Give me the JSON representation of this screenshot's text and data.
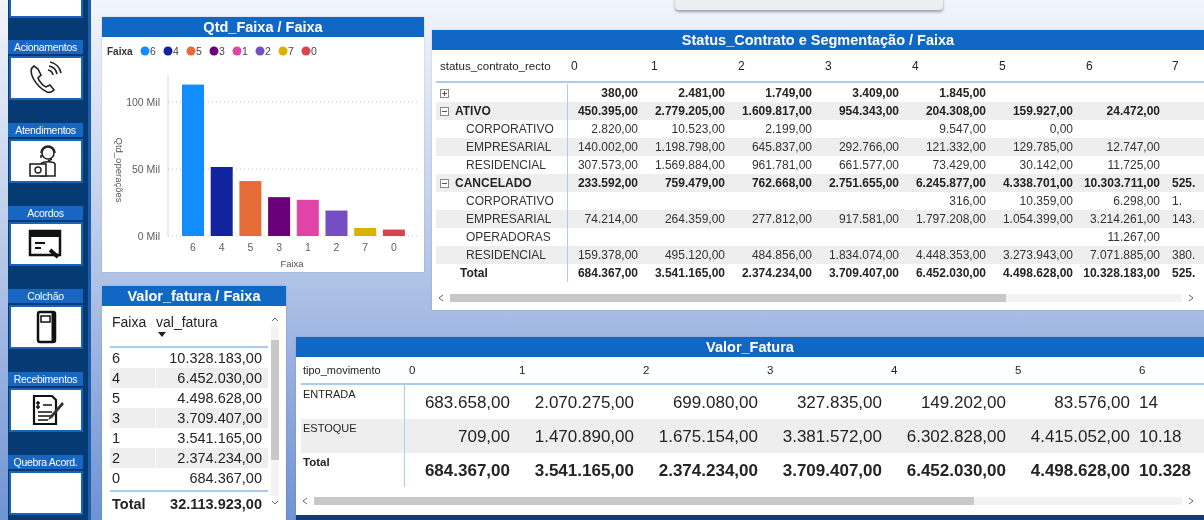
{
  "sidebar": {
    "items": [
      {
        "label": "Acionamentos",
        "kind": "phone"
      },
      {
        "label": "Atendimentos",
        "kind": "agent"
      },
      {
        "label": "Acordos",
        "kind": "agreement"
      },
      {
        "label": "Colchão",
        "kind": "notebook"
      },
      {
        "label": "Recebimentos",
        "kind": "invoice"
      },
      {
        "label": "Quebra Acord.",
        "kind": "blank"
      }
    ]
  },
  "qtd_chart": {
    "title": "Qtd_Faixa / Faixa",
    "legend_title": "Faixa",
    "chart_data": {
      "type": "bar",
      "xlabel": "Faixa",
      "ylabel": "Qtd_operações",
      "categories": [
        "6",
        "4",
        "5",
        "3",
        "1",
        "2",
        "7",
        "0"
      ],
      "stacked": true,
      "legend": "top-left",
      "ylim": [
        0,
        120
      ],
      "yticks": [
        {
          "value": 0,
          "label": "0 Mil"
        },
        {
          "value": 50,
          "label": "50 Mil"
        },
        {
          "value": 100,
          "label": "100 Mil"
        }
      ],
      "series": [
        {
          "name": "6",
          "color": "#118dff",
          "values": [
            113,
            null,
            null,
            null,
            null,
            null,
            null,
            null
          ]
        },
        {
          "name": "4",
          "color": "#12239e",
          "values": [
            null,
            51.5,
            null,
            null,
            null,
            null,
            null,
            null
          ]
        },
        {
          "name": "5",
          "color": "#e66c37",
          "values": [
            null,
            null,
            41,
            null,
            null,
            null,
            null,
            null
          ]
        },
        {
          "name": "3",
          "color": "#6b007b",
          "values": [
            null,
            null,
            null,
            29,
            null,
            null,
            null,
            null
          ]
        },
        {
          "name": "1",
          "color": "#e044a7",
          "values": [
            null,
            null,
            null,
            null,
            27,
            null,
            null,
            null
          ]
        },
        {
          "name": "2",
          "color": "#744ec2",
          "values": [
            null,
            null,
            null,
            null,
            null,
            19,
            null,
            null
          ]
        },
        {
          "name": "7",
          "color": "#d9b300",
          "values": [
            null,
            null,
            null,
            null,
            null,
            null,
            6,
            null
          ]
        },
        {
          "name": "0",
          "color": "#d64550",
          "values": [
            null,
            null,
            null,
            null,
            null,
            null,
            null,
            4.8
          ]
        }
      ]
    }
  },
  "status_matrix": {
    "title": "Status_Contrato e Segmentação / Faixa",
    "row_header": "status_contrato_recto",
    "columns": [
      "0",
      "1",
      "2",
      "3",
      "4",
      "5",
      "6",
      "7"
    ],
    "rows": [
      {
        "expanded": false,
        "cells": {
          "col_0": "380,00",
          "col_1": "2.481,00",
          "col_2": "1.749,00",
          "col_3": "3.409,00",
          "col_4": "1.845,00"
        }
      },
      {
        "label": "ATIVO",
        "expanded": true,
        "cells": {
          "col_0": "450.395,00",
          "col_1": "2.779.205,00",
          "col_2": "1.609.817,00",
          "col_3": "954.343,00",
          "col_4": "204.308,00",
          "col_5": "159.927,00",
          "col_6": "24.472,00"
        },
        "children": [
          {
            "label": "CORPORATIVO",
            "cells": {
              "col_0": "2.820,00",
              "col_1": "10.523,00",
              "col_2": "2.199,00",
              "col_4": "9.547,00",
              "col_5": "0,00"
            }
          },
          {
            "label": "EMPRESARIAL",
            "cells": {
              "col_0": "140.002,00",
              "col_1": "1.198.798,00",
              "col_2": "645.837,00",
              "col_3": "292.766,00",
              "col_4": "121.332,00",
              "col_5": "129.785,00",
              "col_6": "12.747,00"
            }
          },
          {
            "label": "RESIDENCIAL",
            "cells": {
              "col_0": "307.573,00",
              "col_1": "1.569.884,00",
              "col_2": "961.781,00",
              "col_3": "661.577,00",
              "col_4": "73.429,00",
              "col_5": "30.142,00",
              "col_6": "11.725,00"
            }
          }
        ]
      },
      {
        "label": "CANCELADO",
        "expanded": true,
        "cells": {
          "col_0": "233.592,00",
          "col_1": "759.479,00",
          "col_2": "762.668,00",
          "col_3": "2.751.655,00",
          "col_4": "6.245.877,00",
          "col_5": "4.338.701,00",
          "col_6": "10.303.711,00",
          "col_7": "525."
        },
        "children": [
          {
            "label": "CORPORATIVO",
            "cells": {
              "col_4": "316,00",
              "col_5": "10.359,00",
              "col_6": "6.298,00",
              "col_7": "1."
            }
          },
          {
            "label": "EMPRESARIAL",
            "cells": {
              "col_0": "74.214,00",
              "col_1": "264.359,00",
              "col_2": "277.812,00",
              "col_3": "917.581,00",
              "col_4": "1.797.208,00",
              "col_5": "1.054.399,00",
              "col_6": "3.214.261,00",
              "col_7": "143."
            }
          },
          {
            "label": "OPERADORAS",
            "cells": {
              "col_6": "11.267,00"
            }
          },
          {
            "label": "RESIDENCIAL",
            "cells": {
              "col_0": "159.378,00",
              "col_1": "495.120,00",
              "col_2": "484.856,00",
              "col_3": "1.834.074,00",
              "col_4": "4.448.353,00",
              "col_5": "3.273.943,00",
              "col_6": "7.071.885,00",
              "col_7": "380."
            }
          }
        ]
      }
    ],
    "total": {
      "label": "Total",
      "cells": {
        "col_0": "684.367,00",
        "col_1": "3.541.165,00",
        "col_2": "2.374.234,00",
        "col_3": "3.709.407,00",
        "col_4": "6.452.030,00",
        "col_5": "4.498.628,00",
        "col_6": "10.328.183,00",
        "col_7": "525."
      }
    }
  },
  "valor_table": {
    "title": "Valor_fatura / Faixa",
    "columns": [
      {
        "label": "Faixa",
        "sorted_descending": false
      },
      {
        "label": "val_fatura",
        "sorted_descending": true
      }
    ],
    "rows": [
      [
        "6",
        "10.328.183,00"
      ],
      [
        "4",
        "6.452.030,00"
      ],
      [
        "5",
        "4.498.628,00"
      ],
      [
        "3",
        "3.709.407,00"
      ],
      [
        "1",
        "3.541.165,00"
      ],
      [
        "2",
        "2.374.234,00"
      ],
      [
        "0",
        "684.367,00"
      ]
    ],
    "total": [
      "Total",
      "32.113.923,00"
    ]
  },
  "valor_matrix": {
    "title": "Valor_Fatura",
    "row_header": "tipo_movimento",
    "columns": [
      "0",
      "1",
      "2",
      "3",
      "4",
      "5",
      "6"
    ],
    "rows": [
      {
        "label": "ENTRADA",
        "cells": {
          "col_0": "683.658,00",
          "col_1": "2.070.275,00",
          "col_2": "699.080,00",
          "col_3": "327.835,00",
          "col_4": "149.202,00",
          "col_5": "83.576,00",
          "col_6": "14"
        }
      },
      {
        "label": "ESTOQUE",
        "cells": {
          "col_0": "709,00",
          "col_1": "1.470.890,00",
          "col_2": "1.675.154,00",
          "col_3": "3.381.572,00",
          "col_4": "6.302.828,00",
          "col_5": "4.415.052,00",
          "col_6": "10.18"
        }
      }
    ],
    "total": {
      "label": "Total",
      "cells": {
        "col_0": "684.367,00",
        "col_1": "3.541.165,00",
        "col_2": "2.374.234,00",
        "col_3": "3.709.407,00",
        "col_4": "6.452.030,00",
        "col_5": "4.498.628,00",
        "col_6": "10.328"
      }
    }
  }
}
